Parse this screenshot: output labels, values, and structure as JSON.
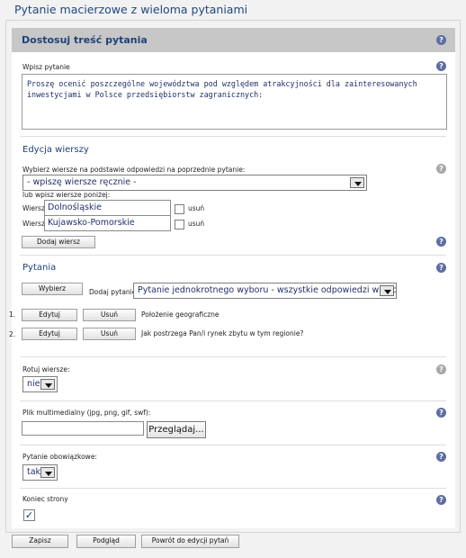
{
  "page": {
    "title": "Pytanie macierzowe z wieloma pytaniami"
  },
  "header": {
    "title": "Dostosuj treść pytania",
    "help": "?"
  },
  "question": {
    "label": "Wpisz pytanie",
    "text_line1": "Proszę ocenić poszczególne województwa pod względem atrakcyjności dla zainteresowanych",
    "text_line2": "inwestycjami w Polsce przedsiębiorstw zagranicznych:"
  },
  "rows": {
    "heading": "Edycja wierszy",
    "select_label": "Wybierz wiersze na podstawie odpowiedzi na poprzednie pytanie:",
    "select_value": "- wpiszę wiersze ręcznie -",
    "manual_label": "lub wpisz wiersze poniżej:",
    "row_label": "Wiersz:",
    "remove_label": "usuń",
    "items": [
      "Dolnośląskie",
      "Kujawsko-Pomorskie"
    ],
    "add_button": "Dodaj wiersz"
  },
  "questions": {
    "heading": "Pytania",
    "choose_button": "Wybierz",
    "add_label": "Dodaj pytanie:",
    "type_value": "Pytanie jednokrotnego wyboru - wszystkie odpowiedzi widoczne",
    "edit_label": "Edytuj",
    "delete_label": "Usuń",
    "items": [
      {
        "num": "1.",
        "text": "Położenie geograficzne"
      },
      {
        "num": "2.",
        "text": "Jak postrzega Pan/i rynek zbytu w tym regionie?"
      }
    ]
  },
  "rotate": {
    "label": "Rotuj wiersze:",
    "value": "nie"
  },
  "media": {
    "label": "Plik multimedialny (jpg, png, gif, swf):",
    "value": "",
    "browse_button": "Przeglądaj..."
  },
  "required": {
    "label": "Pytanie obowiązkowe:",
    "value": "tak"
  },
  "page_end": {
    "label": "Koniec strony",
    "checked": true,
    "check_mark": "✓"
  },
  "footer": {
    "save_button": "Zapisz",
    "preview_button": "Podgląd",
    "back_button": "Powrót do edycji pytań"
  },
  "colors": {
    "accent": "#20427a",
    "header_bg": "#c7c7c7",
    "help_icon": "#5d6ea3"
  }
}
